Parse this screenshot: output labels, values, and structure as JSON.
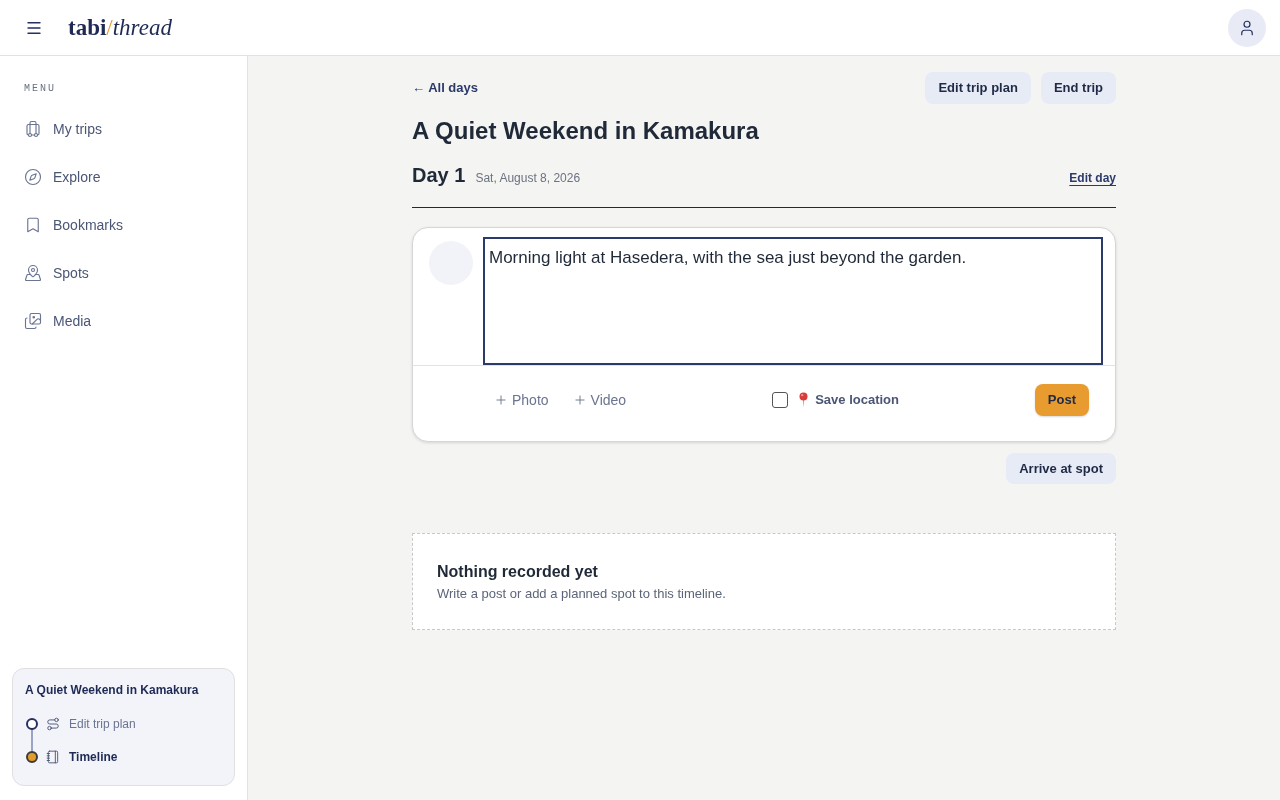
{
  "header": {
    "logo": {
      "word": "tabi",
      "separator": "/",
      "accent_word": "thread"
    }
  },
  "sidebar": {
    "section_label": "MENU",
    "items": [
      {
        "label": "My trips",
        "selected": false
      },
      {
        "label": "Explore",
        "selected": false
      },
      {
        "label": "Bookmarks",
        "selected": false
      },
      {
        "label": "Spots",
        "selected": false
      },
      {
        "label": "Media",
        "selected": false
      }
    ],
    "trip_card": {
      "title": "A Quiet Weekend in Kamakura",
      "steps": [
        {
          "label": "Edit trip plan",
          "selected": false
        },
        {
          "label": "Timeline",
          "selected": true
        }
      ]
    }
  },
  "main": {
    "back_link": "← All days",
    "actions": [
      "Edit trip plan",
      "End trip"
    ],
    "title": "A Quiet Weekend in Kamakura",
    "day": {
      "label": "Day 1",
      "date": "Sat, August 8, 2026",
      "edit_link": "Edit day"
    },
    "composer": {
      "value": "Morning light at Hasedera, with the sea just beyond the garden.",
      "attachments": [
        "Photo",
        "Video"
      ],
      "save_location": {
        "label": "Save location",
        "checked": false
      },
      "submit": "Post"
    },
    "arrive_button": "Arrive at spot",
    "empty_state": {
      "title": "Nothing recorded yet",
      "message": "Write a post or add a planned spot to this timeline."
    }
  }
}
